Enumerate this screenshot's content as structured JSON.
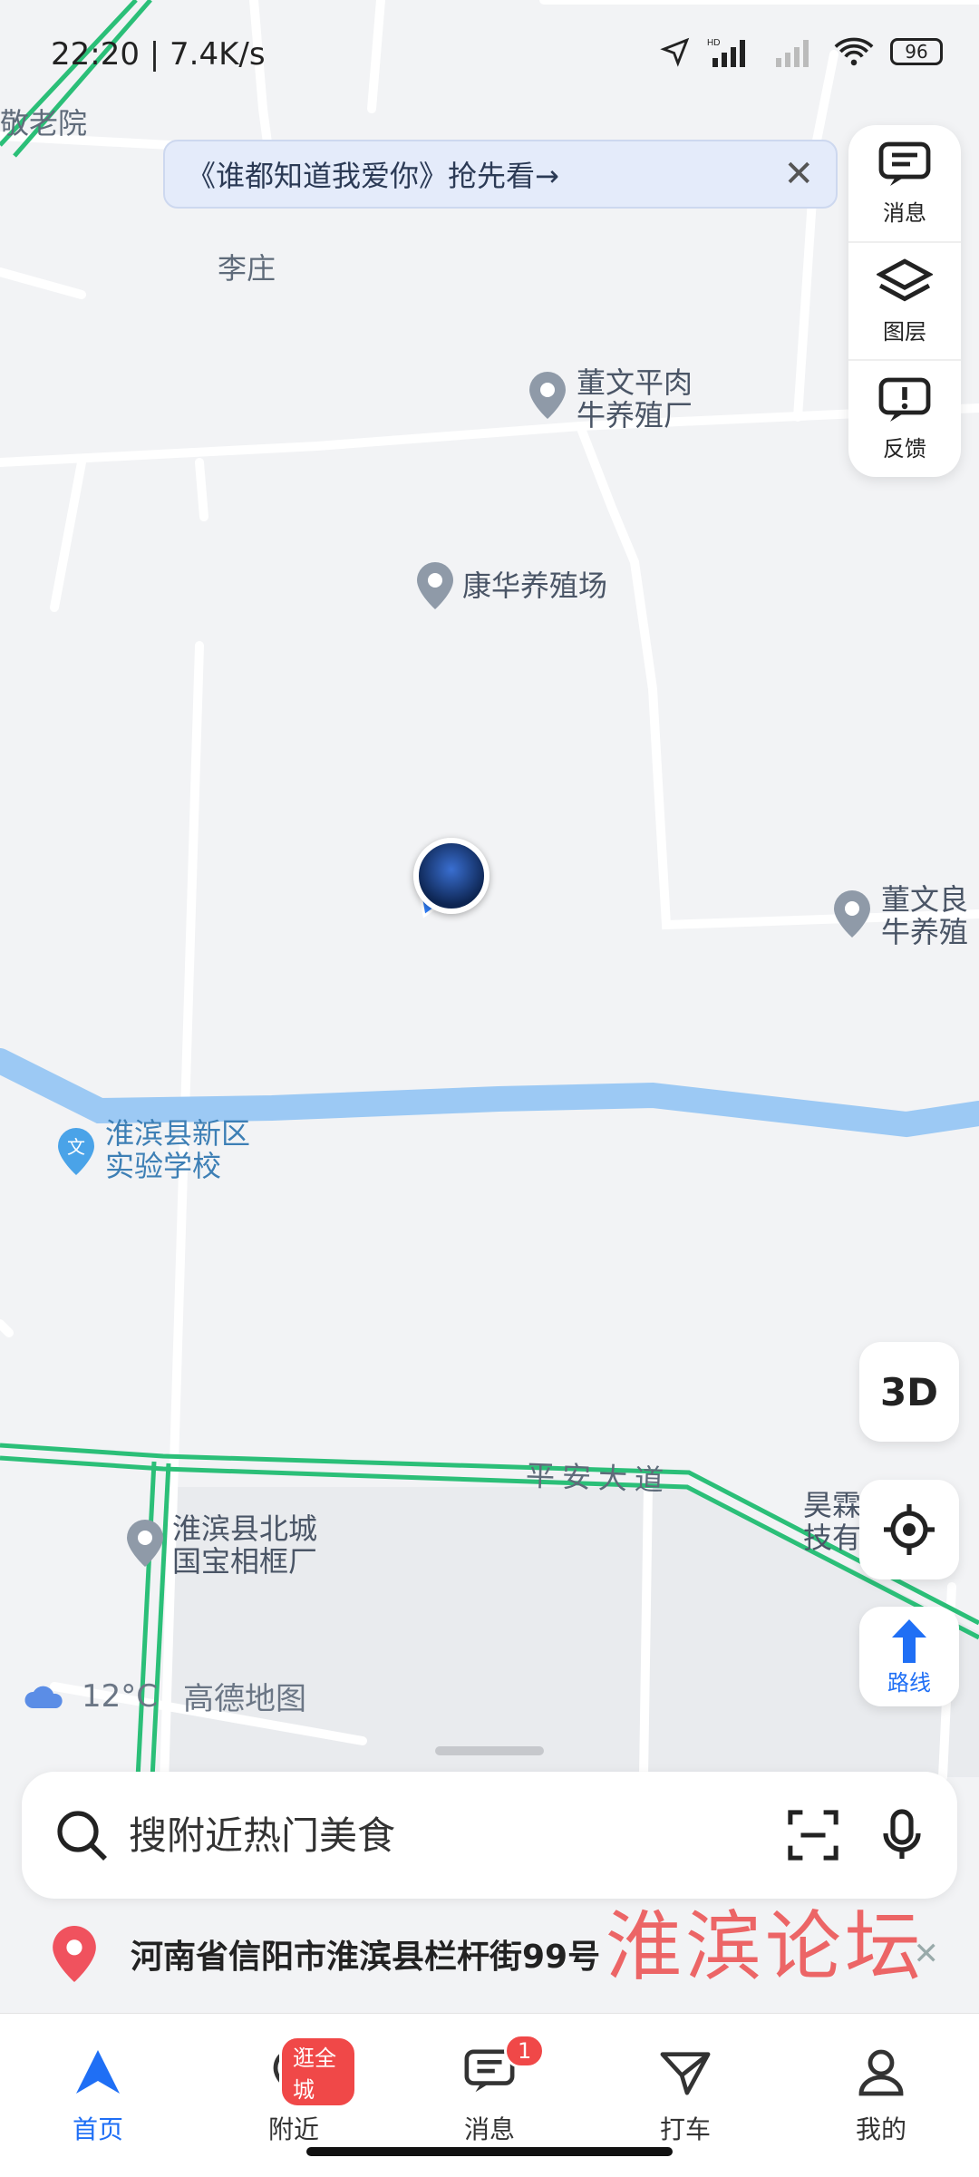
{
  "status_bar": {
    "time": "22:20 | 7.4K/s",
    "battery": "96"
  },
  "banner": {
    "text": "《谁都知道我爱你》抢先看→"
  },
  "toolbar": {
    "messages": "消息",
    "layers": "图层",
    "feedback": "反馈"
  },
  "map_labels": {
    "elder_home": "敬老院",
    "lizhuang": "李庄",
    "poi1_line1": "董文平肉",
    "poi1_line2": "牛养殖厂",
    "poi2": "康华养殖场",
    "poi3_line1": "董文良",
    "poi3_line2": "牛养殖",
    "school_line1": "淮滨县新区",
    "school_line2": "实验学校",
    "road": "平安大道",
    "poi4_line1": "淮滨县北城",
    "poi4_line2": "国宝相框厂",
    "poi5_line1": "昊霖",
    "poi5_line2": "技有"
  },
  "buttons": {
    "three_d": "3D",
    "route": "路线"
  },
  "weather": {
    "temp": "12°C",
    "brand": "高德地图"
  },
  "search": {
    "placeholder": "搜附近热门美食"
  },
  "address": {
    "text": "河南省信阳市淮滨县栏杆街99号"
  },
  "watermark": "淮滨论坛",
  "nav": {
    "home": "首页",
    "nearby": "附近",
    "nearby_badge": "逛全城",
    "messages": "消息",
    "messages_badge": "1",
    "taxi": "打车",
    "mine": "我的"
  },
  "colors": {
    "accent": "#1f6ff5",
    "road_green": "#2bbf78",
    "river": "#9cc9f4",
    "badge_red": "#f04848"
  }
}
